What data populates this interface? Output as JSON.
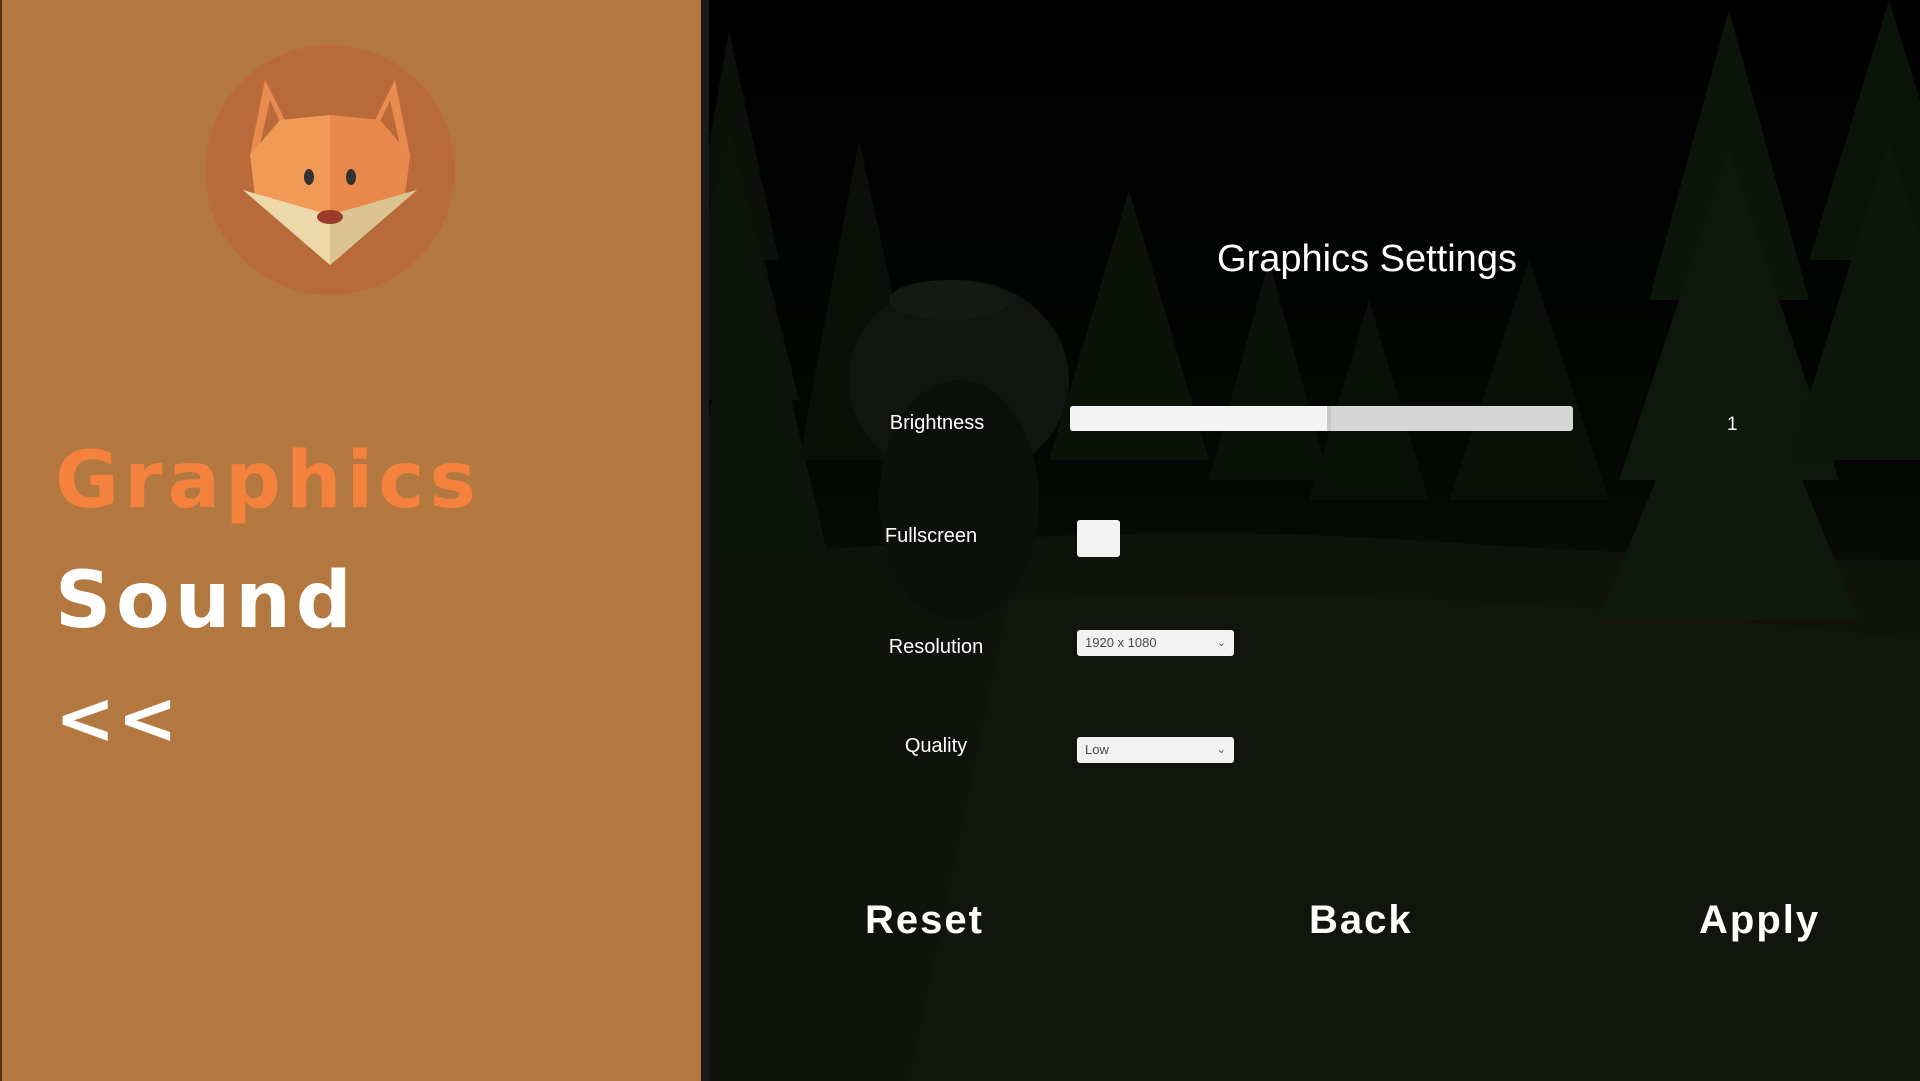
{
  "menu": {
    "graphics_label": "Graphics",
    "sound_label": "Sound",
    "back_label": "<<"
  },
  "settings": {
    "title": "Graphics Settings",
    "brightness": {
      "label": "Brightness",
      "value_text": "1",
      "fill_fraction": 0.51
    },
    "fullscreen": {
      "label": "Fullscreen",
      "checked": false
    },
    "resolution": {
      "label": "Resolution",
      "selected": "1920 x 1080"
    },
    "quality": {
      "label": "Quality",
      "selected": "Low"
    }
  },
  "actions": {
    "reset_label": "Reset",
    "back_label": "Back",
    "apply_label": "Apply"
  },
  "colors": {
    "panel": "#b37840",
    "active_menu": "#f5823c",
    "text": "#ffffff",
    "fox_orange": "#f09050",
    "fox_cream": "#ecd8a8"
  },
  "icons": {
    "logo": "fox-head-icon",
    "dropdown": "chevron-down-icon"
  }
}
